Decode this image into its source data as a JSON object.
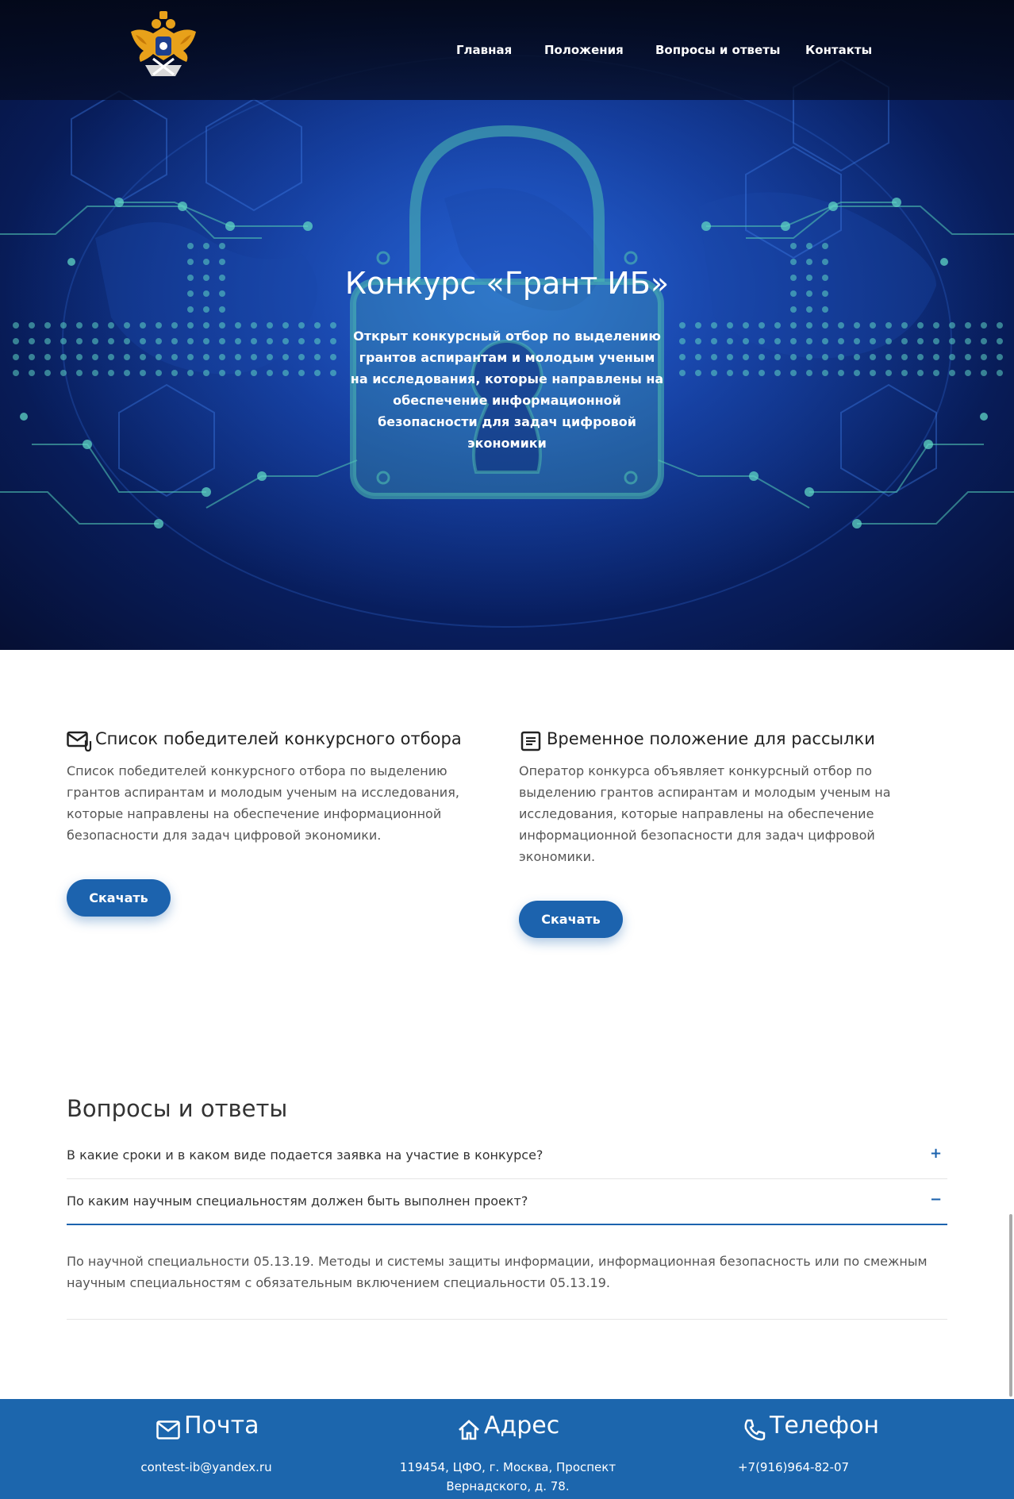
{
  "nav": {
    "items": [
      "Главная",
      "Положения",
      "Вопросы и ответы",
      "Контакты"
    ]
  },
  "hero": {
    "title": "Конкурс «Грант ИБ»",
    "subtitle": "Открыт конкурсный отбор по выделению грантов аспирантам и молодым ученым на исследования, которые направлены на обеспечение информационной безопасности для задач цифровой экономики"
  },
  "cards": [
    {
      "icon": "mail-attachment-icon",
      "title": "Список победителей конкурсного отбора",
      "text": "Список победителей конкурсного отбора по выделению грантов аспирантам и молодым ученым на исследования, которые направлены на обеспечение информационной безопасности для задач цифровой экономики.",
      "button": "Скачать"
    },
    {
      "icon": "document-icon",
      "title": "Временное положение для рассылки",
      "text": "Оператор конкурса объявляет конкурсный отбор по выделению грантов аспирантам и молодым ученым на исследования, которые направлены на обеспечение информационной безопасности для задач цифровой экономики.",
      "button": "Скачать"
    }
  ],
  "faq": {
    "title": "Вопросы и ответы",
    "items": [
      {
        "question": "В какие сроки и в каком виде подается заявка на участие в конкурсе?",
        "toggle": "+"
      },
      {
        "question": "По каким научным специальностям должен быть выполнен проект?",
        "toggle": "−",
        "answer": "По научной специальности 05.13.19. Методы и системы защиты информации, информационная безопасность или по смежным научным специальностям с обязательным включением специальности 05.13.19."
      }
    ]
  },
  "footer": {
    "mail": {
      "title": "Почта",
      "value": "contest-ib@yandex.ru",
      "icon": "mail-icon"
    },
    "address": {
      "title": "Адрес",
      "value": "119454, ЦФО, г. Москва, Проспект Вернадского, д. 78.",
      "icon": "home-icon"
    },
    "phone": {
      "title": "Телефон",
      "value": "+7(916)964-82-07",
      "icon": "phone-icon"
    }
  },
  "colors": {
    "accent": "#1c63ae",
    "footer": "#1c66ad",
    "hero_dark": "#060f33"
  }
}
